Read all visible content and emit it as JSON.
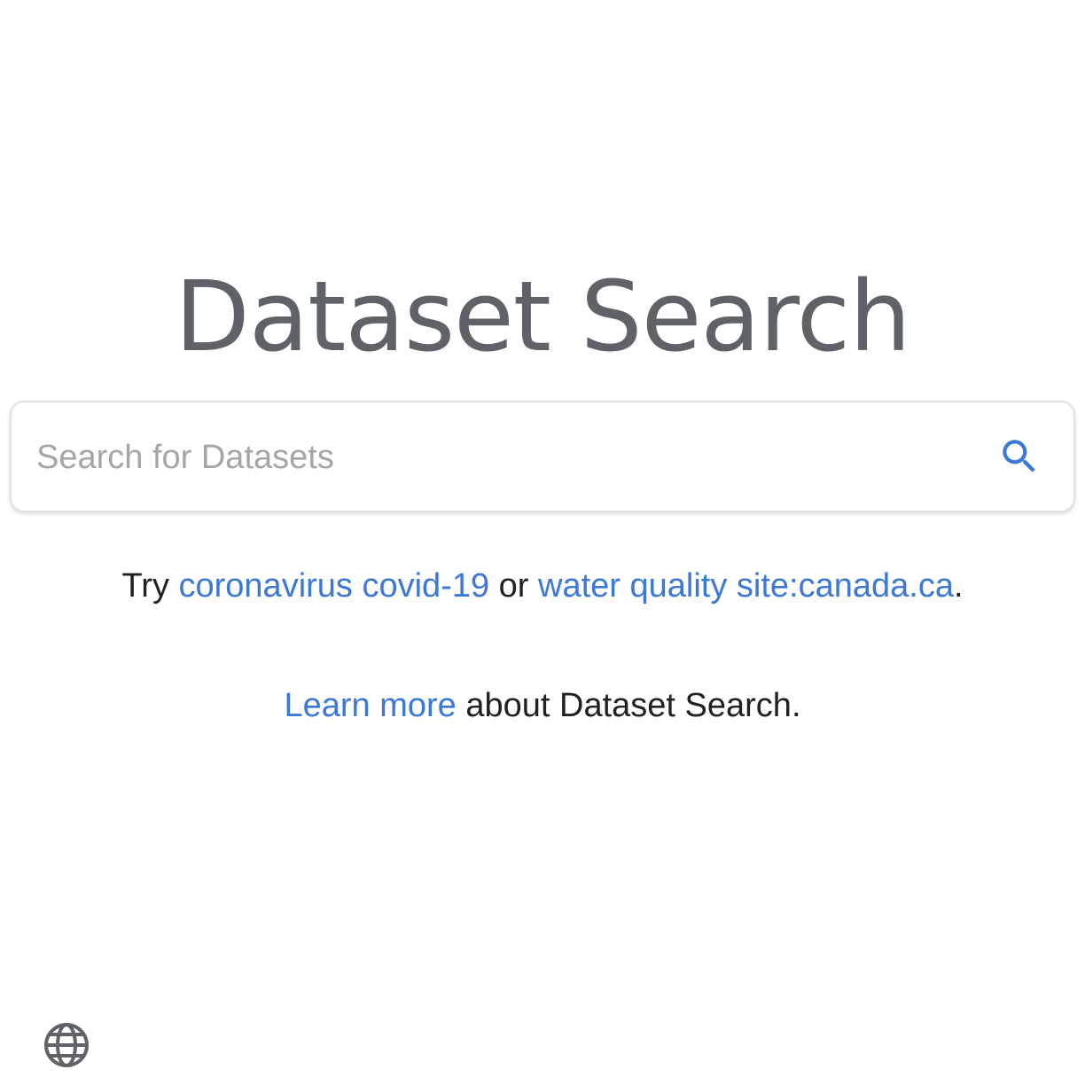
{
  "title": "Dataset Search",
  "search": {
    "placeholder": "Search for Datasets",
    "value": "",
    "button_icon": "search-icon"
  },
  "suggestions": {
    "prefix": "Try ",
    "first_link": "coronavirus covid-19",
    "separator": " or ",
    "second_link": "water quality site:canada.ca",
    "suffix": "."
  },
  "learn_more": {
    "link": "Learn more",
    "text": " about Dataset Search."
  },
  "footer": {
    "language_icon": "globe-icon"
  },
  "colors": {
    "title": "#5f6368",
    "link": "#3b78d8",
    "search_icon": "#3b78d8",
    "text": "#202124",
    "placeholder": "#a6a6a6"
  }
}
